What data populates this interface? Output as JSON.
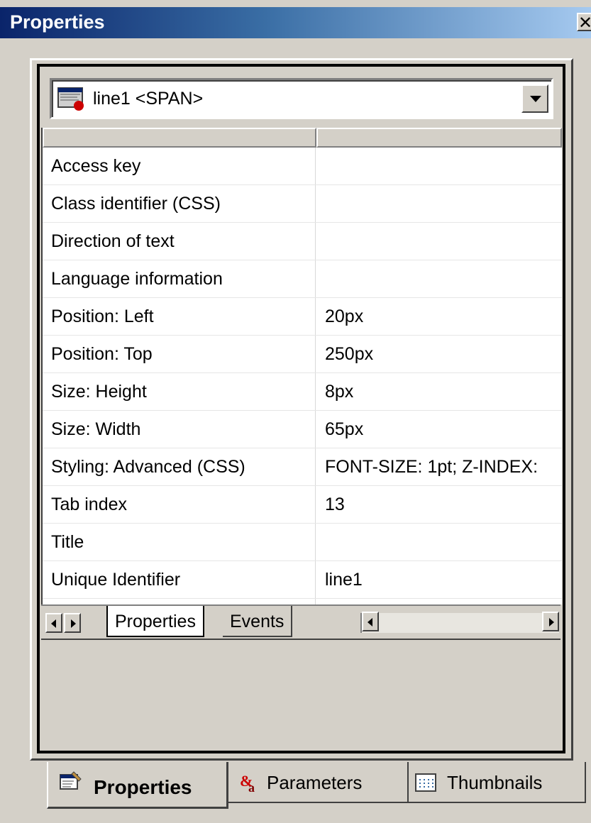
{
  "window": {
    "title": "Properties",
    "close_symbol": "✕"
  },
  "object_selector": {
    "value": "line1 <SPAN>",
    "icon": "html-element-icon"
  },
  "property_grid": {
    "rows": [
      {
        "name": "Access key",
        "value": ""
      },
      {
        "name": "Class identifier (CSS)",
        "value": ""
      },
      {
        "name": "Direction of text",
        "value": ""
      },
      {
        "name": "Language information",
        "value": ""
      },
      {
        "name": "Position: Left",
        "value": "20px"
      },
      {
        "name": "Position: Top",
        "value": "250px"
      },
      {
        "name": "Size: Height",
        "value": "8px"
      },
      {
        "name": "Size: Width",
        "value": "65px"
      },
      {
        "name": "Styling: Advanced (CSS)",
        "value": "FONT-SIZE: 1pt; Z-INDEX:"
      },
      {
        "name": "Tab index",
        "value": "13"
      },
      {
        "name": "Title",
        "value": ""
      },
      {
        "name": "Unique Identifier",
        "value": "line1"
      }
    ],
    "tabs": [
      {
        "label": "Properties",
        "active": true
      },
      {
        "label": "Events",
        "active": false
      }
    ]
  },
  "panel_tabs": [
    {
      "label": "Properties",
      "icon": "properties-icon",
      "active": true
    },
    {
      "label": "Parameters",
      "icon": "parameters-icon",
      "active": false
    },
    {
      "label": "Thumbnails",
      "icon": "thumbnails-icon",
      "active": false
    }
  ]
}
